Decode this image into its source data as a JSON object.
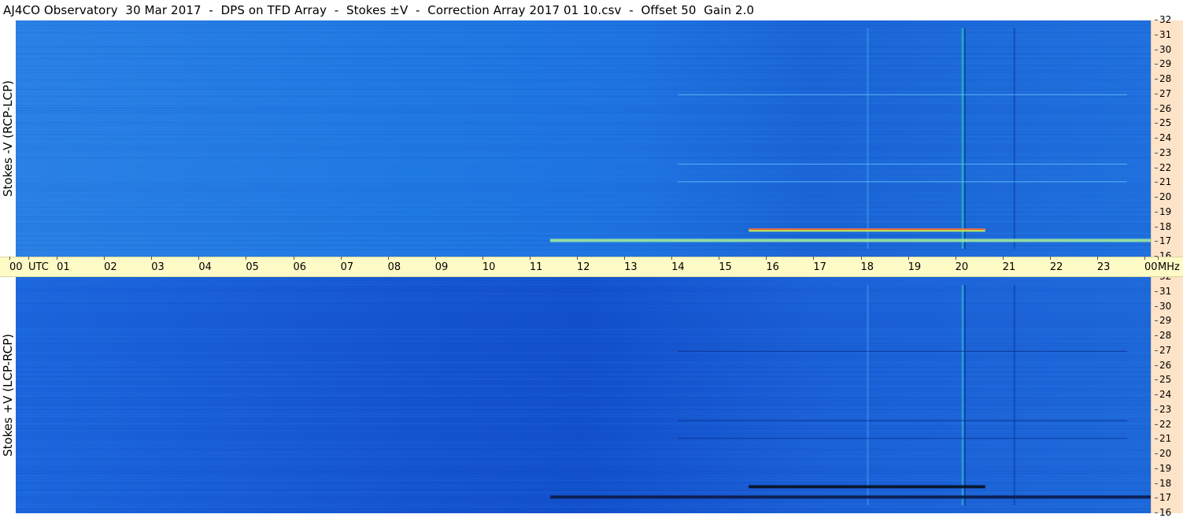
{
  "title": "AJ4CO Observatory  30 Mar 2017  -  DPS on TFD Array  -  Stokes ±V  -  Correction Array 2017 01 10.csv  -  Offset 50  Gain 2.0",
  "chart_data": [
    {
      "type": "heatmap",
      "ylabel": "Stokes -V (RCP-LCP)",
      "x_axis_label": "UTC",
      "y_unit": "MHz",
      "x_ticks": [
        "00",
        "01",
        "02",
        "03",
        "04",
        "05",
        "06",
        "07",
        "08",
        "09",
        "10",
        "11",
        "12",
        "13",
        "14",
        "15",
        "16",
        "17",
        "18",
        "19",
        "20",
        "21",
        "22",
        "23",
        "00"
      ],
      "y_ticks": [
        "32",
        "31",
        "30",
        "29",
        "28",
        "27",
        "26",
        "25",
        "24",
        "23",
        "22",
        "21",
        "20",
        "19",
        "18",
        "17",
        "16"
      ],
      "xlim": [
        0,
        24
      ],
      "ylim": [
        16,
        32
      ],
      "base_color": "#1e73e0",
      "bright_color": "#9fe87a",
      "hot_color": "#ff4a3a",
      "bursts": [
        {
          "start_hr": 15.5,
          "end_hr": 20.5,
          "freq_mhz": 17.8,
          "color": "#c8ff50"
        },
        {
          "start_hr": 11.3,
          "end_hr": 24.0,
          "freq_mhz": 17.1,
          "color": "#9fe8a0"
        }
      ]
    },
    {
      "type": "heatmap",
      "ylabel": "Stokes +V (LCP-RCP)",
      "x_axis_label": "UTC",
      "y_unit": "MHz",
      "x_ticks": [
        "00",
        "01",
        "02",
        "03",
        "04",
        "05",
        "06",
        "07",
        "08",
        "09",
        "10",
        "11",
        "12",
        "13",
        "14",
        "15",
        "16",
        "17",
        "18",
        "19",
        "20",
        "21",
        "22",
        "23",
        "00"
      ],
      "y_ticks": [
        "32",
        "31",
        "30",
        "29",
        "28",
        "27",
        "26",
        "25",
        "24",
        "23",
        "22",
        "21",
        "20",
        "19",
        "18",
        "17",
        "16"
      ],
      "xlim": [
        0,
        24
      ],
      "ylim": [
        16,
        32
      ],
      "base_color": "#1a5fd6",
      "dark_color": "#0a1a40",
      "bursts": [
        {
          "start_hr": 15.5,
          "end_hr": 20.5,
          "freq_mhz": 17.8,
          "color": "#0a1020"
        },
        {
          "start_hr": 11.3,
          "end_hr": 24.0,
          "freq_mhz": 17.1,
          "color": "#0c1a48"
        }
      ]
    }
  ],
  "axis": {
    "utc_label": "UTC",
    "mhz_label": "MHz"
  }
}
